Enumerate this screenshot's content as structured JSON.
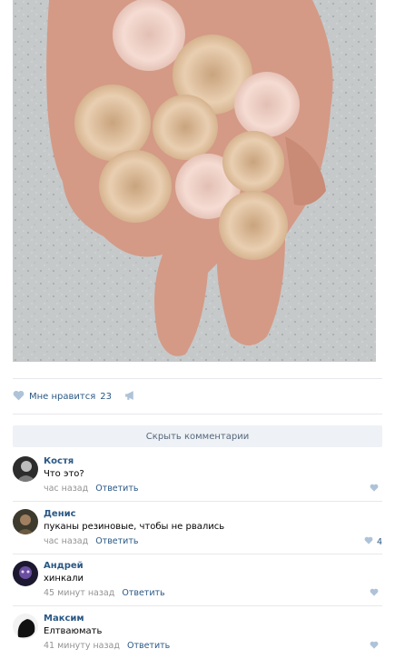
{
  "post": {
    "like_label": "Мне нравится",
    "like_count": "23",
    "hide_comments_label": "Скрыть комментарии"
  },
  "comments": [
    {
      "author": "Костя",
      "text": "Что это?",
      "time": "час назад",
      "reply": "Ответить",
      "likes": ""
    },
    {
      "author": "Денис",
      "text": "пуканы резиновые, чтобы не рвались",
      "time": "час назад",
      "reply": "Ответить",
      "likes": "4"
    },
    {
      "author": "Андрей",
      "text": "хинкали",
      "time": "45 минут назад",
      "reply": "Ответить",
      "likes": ""
    },
    {
      "author": "Максим",
      "text": "Елтваюмать",
      "time": "41 минуту назад",
      "reply": "Ответить",
      "likes": ""
    }
  ],
  "colors": {
    "link": "#2a5885",
    "meta": "#939393",
    "button_bg": "#eef1f5",
    "icon": "#aec3d8"
  },
  "icons": {
    "like": "heart-icon",
    "share": "megaphone-icon"
  }
}
